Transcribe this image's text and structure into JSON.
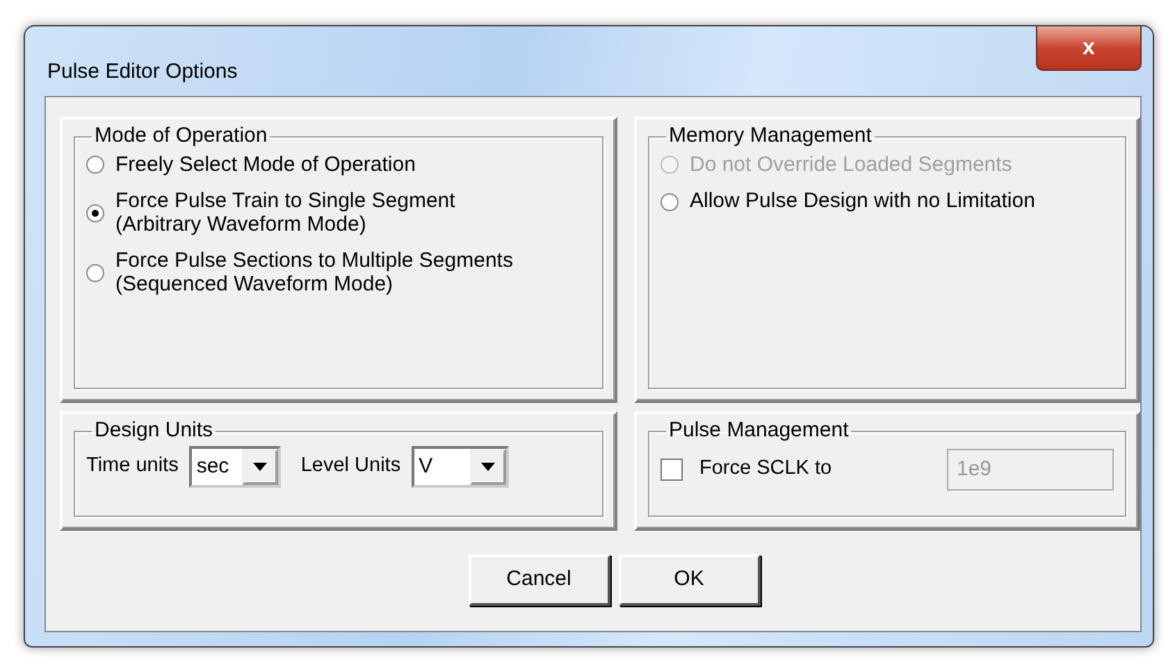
{
  "window": {
    "title": "Pulse Editor Options",
    "close_label": "x"
  },
  "mode_of_operation": {
    "title": "Mode of Operation",
    "options": [
      {
        "label": "Freely Select Mode of Operation",
        "selected": false,
        "disabled": false
      },
      {
        "label": "Force Pulse Train to Single Segment (Arbitrary Waveform Mode)",
        "selected": true,
        "disabled": false
      },
      {
        "label": "Force Pulse Sections to Multiple Segments (Sequenced  Waveform Mode)",
        "selected": false,
        "disabled": false
      }
    ]
  },
  "memory_management": {
    "title": "Memory Management",
    "options": [
      {
        "label": "Do not Override Loaded Segments",
        "selected": false,
        "disabled": true
      },
      {
        "label": "Allow Pulse Design with no Limitation",
        "selected": false,
        "disabled": false
      }
    ]
  },
  "design_units": {
    "title": "Design Units",
    "fields": [
      {
        "label": "Time units",
        "value": "sec"
      },
      {
        "label": "Level Units",
        "value": "V"
      }
    ]
  },
  "pulse_management": {
    "title": "Pulse Management",
    "checkbox": {
      "label": "Force SCLK to",
      "checked": false
    },
    "field": {
      "value": "1e9",
      "disabled": true
    }
  },
  "buttons": [
    "Cancel",
    "OK"
  ]
}
